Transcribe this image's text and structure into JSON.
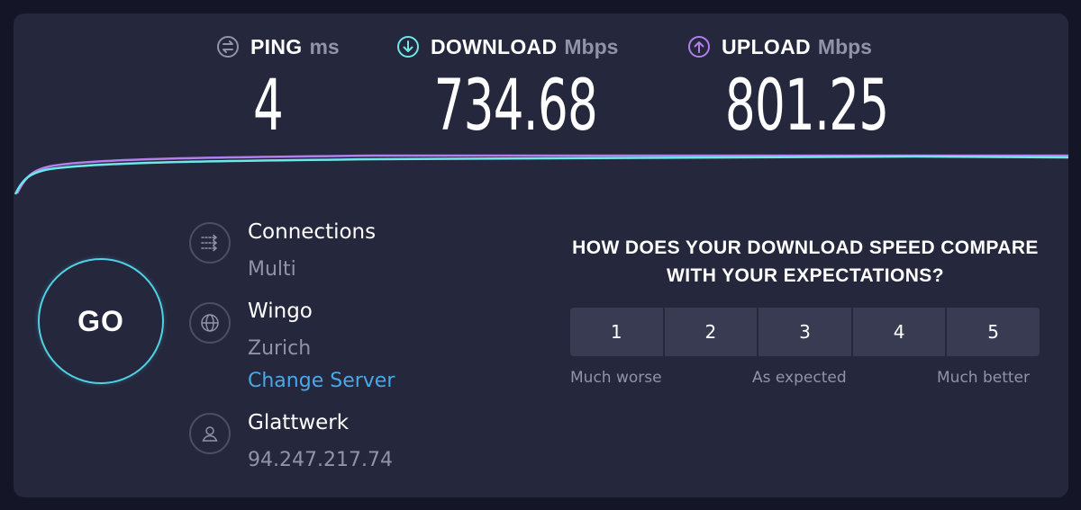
{
  "metrics": {
    "ping": {
      "label": "PING",
      "unit": "ms",
      "value": "4",
      "icon": "ping-icon"
    },
    "download": {
      "label": "DOWNLOAD",
      "unit": "Mbps",
      "value": "734.68",
      "icon": "download-arrow-icon"
    },
    "upload": {
      "label": "UPLOAD",
      "unit": "Mbps",
      "value": "801.25",
      "icon": "upload-arrow-icon"
    }
  },
  "colors": {
    "background": "#141526",
    "panel": "#25273c",
    "download": "#6ee7e9",
    "upload": "#b37fec",
    "ping": "#9193a8",
    "link": "#4aa8e8"
  },
  "go_button": {
    "label": "GO"
  },
  "info": {
    "connections": {
      "title": "Connections",
      "value": "Multi",
      "icon": "connections-icon"
    },
    "server": {
      "title": "Wingo",
      "location": "Zurich",
      "change_label": "Change Server",
      "icon": "globe-icon"
    },
    "provider": {
      "title": "Glattwerk",
      "ip": "94.247.217.74",
      "icon": "user-icon"
    }
  },
  "survey": {
    "question": "HOW DOES YOUR DOWNLOAD SPEED COMPARE WITH YOUR EXPECTATIONS?",
    "options": [
      "1",
      "2",
      "3",
      "4",
      "5"
    ],
    "labels": {
      "low": "Much worse",
      "mid": "As expected",
      "high": "Much better"
    }
  }
}
